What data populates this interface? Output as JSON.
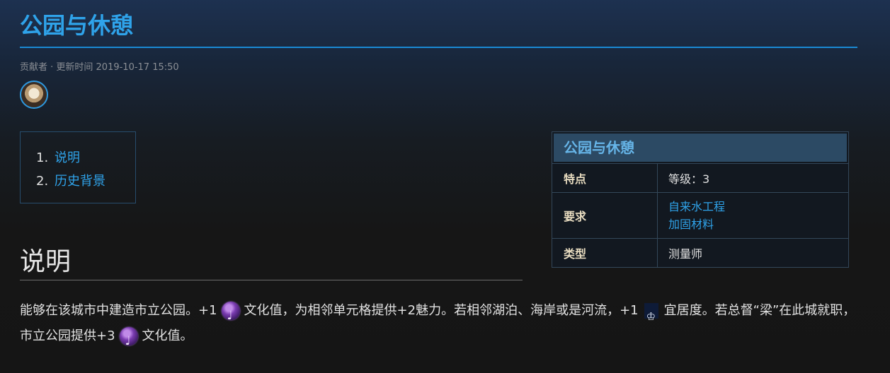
{
  "page": {
    "title": "公园与休憩",
    "meta": "贡献者 · 更新时间 2019-10-17 15:50"
  },
  "toc": [
    {
      "num": "1.",
      "label": "说明"
    },
    {
      "num": "2.",
      "label": "历史背景"
    }
  ],
  "infobox": {
    "title": "公园与休憩",
    "rows": {
      "feature": {
        "key": "特点",
        "value": "等级：3"
      },
      "requirement": {
        "key": "要求",
        "links": [
          "自来水工程",
          "加固材料"
        ]
      },
      "type": {
        "key": "类型",
        "value": "测量师"
      }
    }
  },
  "section": {
    "heading": "说明",
    "text": {
      "p1": "能够在该城市中建造市立公园。+1",
      "p2": "文化值，为相邻单元格提供+2魅力。若相邻湖泊、海岸或是河流，+1",
      "p3": "宜居度。若总督“梁”在此城就职，市立公园提供+3",
      "p4": "文化值。"
    },
    "icons": [
      "culture-icon",
      "amenity-icon"
    ]
  }
}
